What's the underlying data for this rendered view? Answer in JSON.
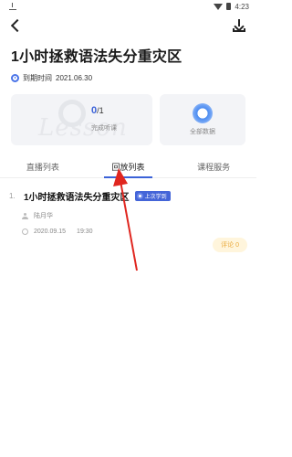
{
  "status_bar": {
    "time": "4:23"
  },
  "page": {
    "title": "1小时拯救语法失分重灾区",
    "deadline_label": "到期时间",
    "deadline_date": "2021.06.30"
  },
  "progress_card": {
    "watermark": "Lesson",
    "done": "0",
    "total": "/1",
    "label": "完成听课"
  },
  "all_card": {
    "label": "全部数据"
  },
  "tabs": [
    {
      "label": "直播列表",
      "active": false
    },
    {
      "label": "回放列表",
      "active": true
    },
    {
      "label": "课程服务",
      "active": false
    }
  ],
  "lessons": [
    {
      "index": "1.",
      "title": "1小时拯救语法失分重灾区",
      "badge": "上次学到",
      "teacher": "陆月华",
      "date": "2020.09.15",
      "time": "19:30",
      "comment_label": "评论 0"
    }
  ],
  "colors": {
    "accent": "#3b62d8",
    "comment_bg": "#fff5dc",
    "comment_text": "#e9a93a",
    "annotation": "#e0261f"
  }
}
